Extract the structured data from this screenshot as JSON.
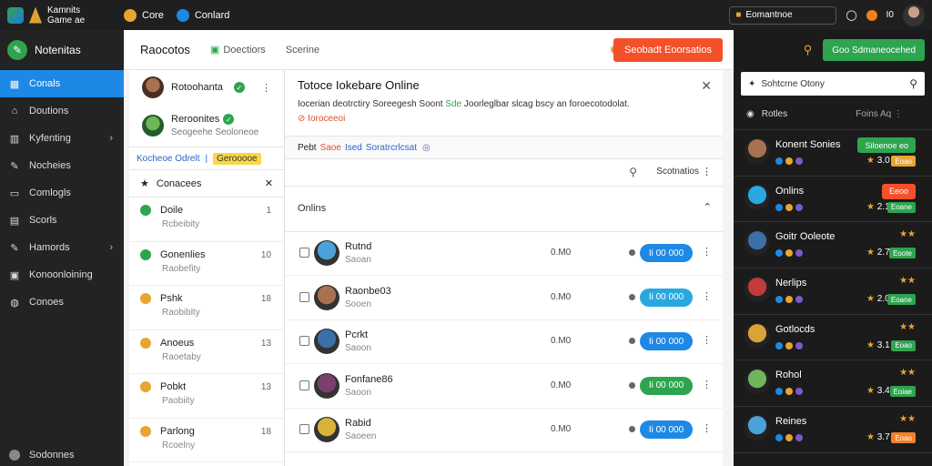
{
  "topbar": {
    "app_name": "Kamnits",
    "app_sub": "Game",
    "app_sub2": "ae",
    "item1": "Core",
    "item2": "Conlard",
    "search_text": "Eomantnoe",
    "right_label": "I0"
  },
  "leftnav": {
    "header": "Notenitas",
    "items": [
      {
        "label": "Conals",
        "icon": "grid-icon",
        "active": true,
        "chevron": false
      },
      {
        "label": "Doutions",
        "icon": "home-icon",
        "active": false,
        "chevron": false
      },
      {
        "label": "Kyfenting",
        "icon": "bars-icon",
        "active": false,
        "chevron": true
      },
      {
        "label": "Nocheies",
        "icon": "wrench-icon",
        "active": false,
        "chevron": false
      },
      {
        "label": "Comlogls",
        "icon": "monitor-icon",
        "active": false,
        "chevron": false
      },
      {
        "label": "Scorls",
        "icon": "list-icon",
        "active": false,
        "chevron": false
      },
      {
        "label": "Hamords",
        "icon": "wrench-icon",
        "active": false,
        "chevron": true
      },
      {
        "label": "Konoonloining",
        "icon": "box-icon",
        "active": false,
        "chevron": false
      },
      {
        "label": "Conoes",
        "icon": "circle-icon",
        "active": false,
        "chevron": false
      }
    ],
    "footer": "Sodonnes"
  },
  "main": {
    "title": "Raocotos",
    "tab1": "Doectiors",
    "tab2": "Scerine",
    "primary_button": "Seobadt Eoorsatios",
    "friend1": "Rotoohanta",
    "friend2": "Reroonites",
    "friend2_sub": "Seogeehe Seoloneoe",
    "status_prefix": "Kocheoe Odrelt",
    "status_sep": "|",
    "status_highlight": "Gerooooe",
    "contacts_title": "Conacees",
    "contacts": [
      {
        "name": "Doile",
        "sub": "Rcbeibity",
        "count": "1",
        "color": "#2ea44f"
      },
      {
        "name": "Gonenlies",
        "sub": "Raobefity",
        "count": "10",
        "color": "#2ea44f"
      },
      {
        "name": "Pshk",
        "sub": "Raobiblty",
        "count": "18",
        "color": "#e8a531"
      },
      {
        "name": "Anoeus",
        "sub": "Raoetaby",
        "count": "13",
        "color": "#e8a531"
      },
      {
        "name": "Pobkt",
        "sub": "Paobiity",
        "count": "13",
        "color": "#e8a531"
      },
      {
        "name": "Parlong",
        "sub": "Rcoelny",
        "count": "18",
        "color": "#e8a531"
      }
    ],
    "detail_title": "Totoce Iokebare Online",
    "detail_desc_a": "Iocerian deotrctiry Soreegesh Soont",
    "detail_desc_g": "Sde",
    "detail_desc_b": "Joorleglbar slcag bscy an foroecotodolat.",
    "detail_warn": "Ioroceeoi",
    "filter_prefix": "Pebt",
    "filter_mid": "Saoe",
    "filter_b": "Ised",
    "filter_tail": "Soratrcrlcsat",
    "sort_label": "Scotnatios",
    "group_label": "Onlins",
    "rows": [
      {
        "name": "Rutnd",
        "sub": "Saoan",
        "time": "0.M0",
        "btn": "Ii 00 000",
        "btn_color": "#1e88e5"
      },
      {
        "name": "Raonbe03",
        "sub": "Sooen",
        "time": "0.M0",
        "btn": "Ii 00 000",
        "btn_color": "#29a8e0"
      },
      {
        "name": "Pcrkt",
        "sub": "Saoon",
        "time": "0.M0",
        "btn": "Ii 00 000",
        "btn_color": "#1e88e5"
      },
      {
        "name": "Fonfane86",
        "sub": "Saoon",
        "time": "0.M0",
        "btn": "Ii 00 000",
        "btn_color": "#2ea44f"
      },
      {
        "name": "Rabid",
        "sub": "Saoeen",
        "time": "0.M0",
        "btn": "Ii 00 000",
        "btn_color": "#1e88e5"
      }
    ]
  },
  "rightpanel": {
    "head_button": "Goo Sdmaneocehed",
    "search_text": "Sohtcrne Otony",
    "sort_label": "Rotles",
    "sort_right": "Foins",
    "sort_right2": "Aq",
    "players": [
      {
        "name": "Konent Sonies",
        "badge": "Siloenoe eo",
        "badge_color": "#2ea44f",
        "score": "3.0",
        "tag": "Eoao",
        "tag_color": "#e8a531"
      },
      {
        "name": "Onlins",
        "badge": "Eeoo",
        "badge_color": "#f4502a",
        "score": "2.1",
        "tag": "Eoane",
        "tag_color": "#2ea44f"
      },
      {
        "name": "Goitr Ooleote",
        "badge": "",
        "badge_color": "",
        "score": "2.7",
        "tag": "Eoote",
        "tag_color": "#2ea44f"
      },
      {
        "name": "Nerlips",
        "badge": "",
        "badge_color": "",
        "score": "2.0",
        "tag": "Eoane",
        "tag_color": "#2ea44f"
      },
      {
        "name": "Gotlocds",
        "badge": "",
        "badge_color": "",
        "score": "3.1",
        "tag": "Eoao",
        "tag_color": "#2ea44f"
      },
      {
        "name": "Rohol",
        "badge": "",
        "badge_color": "",
        "score": "3.4",
        "tag": "Eoiae",
        "tag_color": "#2ea44f"
      },
      {
        "name": "Reines",
        "badge": "",
        "badge_color": "",
        "score": "3.7",
        "tag": "Eoao",
        "tag_color": "#f4802a"
      }
    ]
  },
  "colors": {
    "accent_blue": "#1e88e5",
    "accent_green": "#2ea44f",
    "accent_orange": "#f4502a"
  }
}
